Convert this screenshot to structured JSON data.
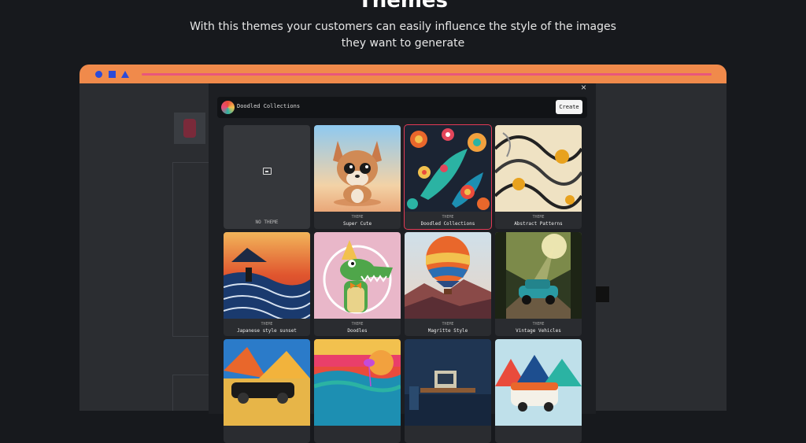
{
  "hero": {
    "title": "Themes",
    "subtitle_line1": "With this themes your customers can easily influence the style of the images",
    "subtitle_line2": "they want to generate"
  },
  "modal": {
    "brand_title": "Doodled Collections",
    "create_label": "Create",
    "close_glyph": "×",
    "none_label": "NO THEME",
    "kicker": "THEME",
    "themes": [
      {
        "name": "Super Cute"
      },
      {
        "name": "Doodled Collections"
      },
      {
        "name": "Abstract Patterns"
      },
      {
        "name": "Japanese style sunset"
      },
      {
        "name": "Doodles"
      },
      {
        "name": "Magritte Style"
      },
      {
        "name": "Vintage Vehicles"
      },
      {
        "name": ""
      },
      {
        "name": ""
      },
      {
        "name": ""
      },
      {
        "name": ""
      }
    ]
  },
  "colors": {
    "accent_bar": "#f08a4b",
    "selected_outline": "#e33a56",
    "browser_dots": "#2b4bd9"
  }
}
